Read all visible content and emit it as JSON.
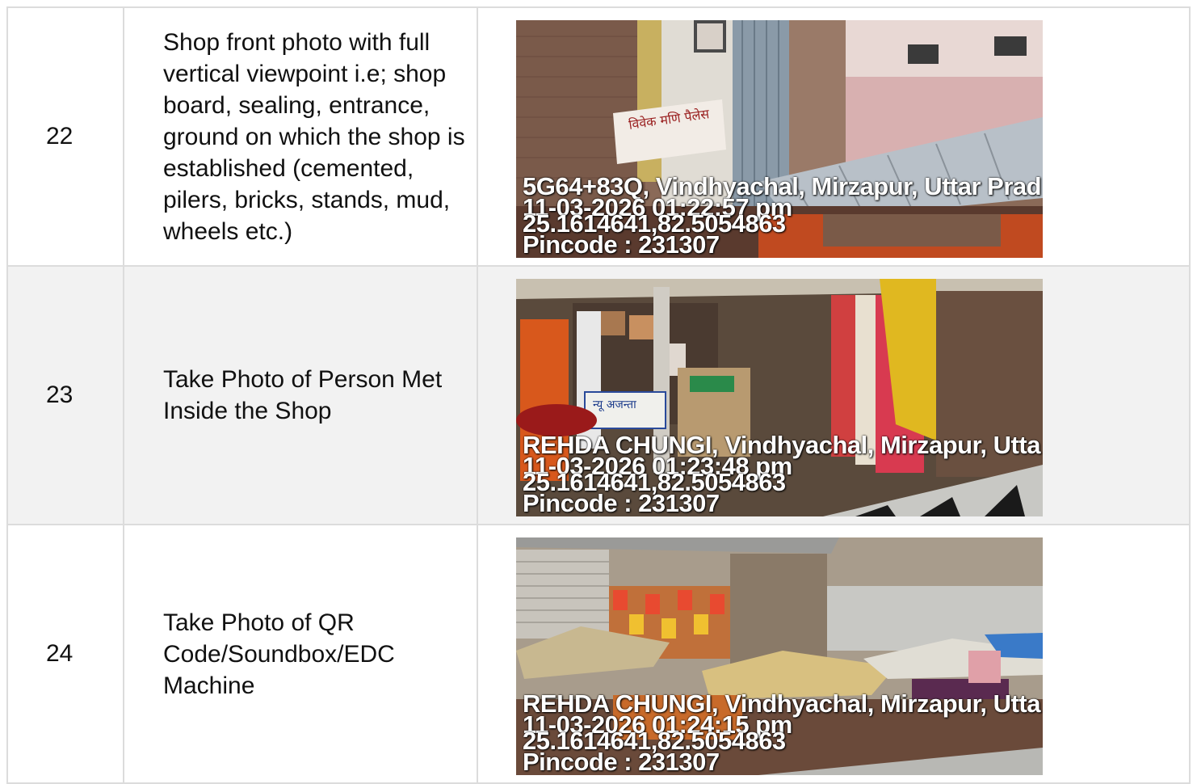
{
  "rows": [
    {
      "number": "22",
      "description": "Shop front photo with full vertical viewpoint i.e; shop board, sealing, entrance, ground on which the shop is established (cemented, pilers, bricks, stands, mud, wheels etc.)",
      "photo": {
        "location": "5G64+83Q, Vindhyachal, Mirzapur, Uttar Prad",
        "datetime": "11-03-2026 01:22:57 pm",
        "coordinates": "25.1614641,82.5054863",
        "pincode": "Pincode : 231307",
        "sign_text": "विवेक मणि पैलेस"
      }
    },
    {
      "number": "23",
      "description": "Take Photo of Person Met Inside the Shop",
      "photo": {
        "location": "REHDA CHUNGI, Vindhyachal, Mirzapur, Utta",
        "datetime": "11-03-2026 01:23:48 pm",
        "coordinates": "25.1614641,82.5054863",
        "pincode": "Pincode : 231307",
        "sign_text": "न्यू अजन्ता"
      }
    },
    {
      "number": "24",
      "description": "Take Photo of QR Code/Soundbox/EDC Machine",
      "photo": {
        "location": "REHDA CHUNGI, Vindhyachal, Mirzapur, Utta",
        "datetime": "11-03-2026 01:24:15 pm",
        "coordinates": "25.1614641,82.5054863",
        "pincode": "Pincode : 231307"
      }
    }
  ]
}
